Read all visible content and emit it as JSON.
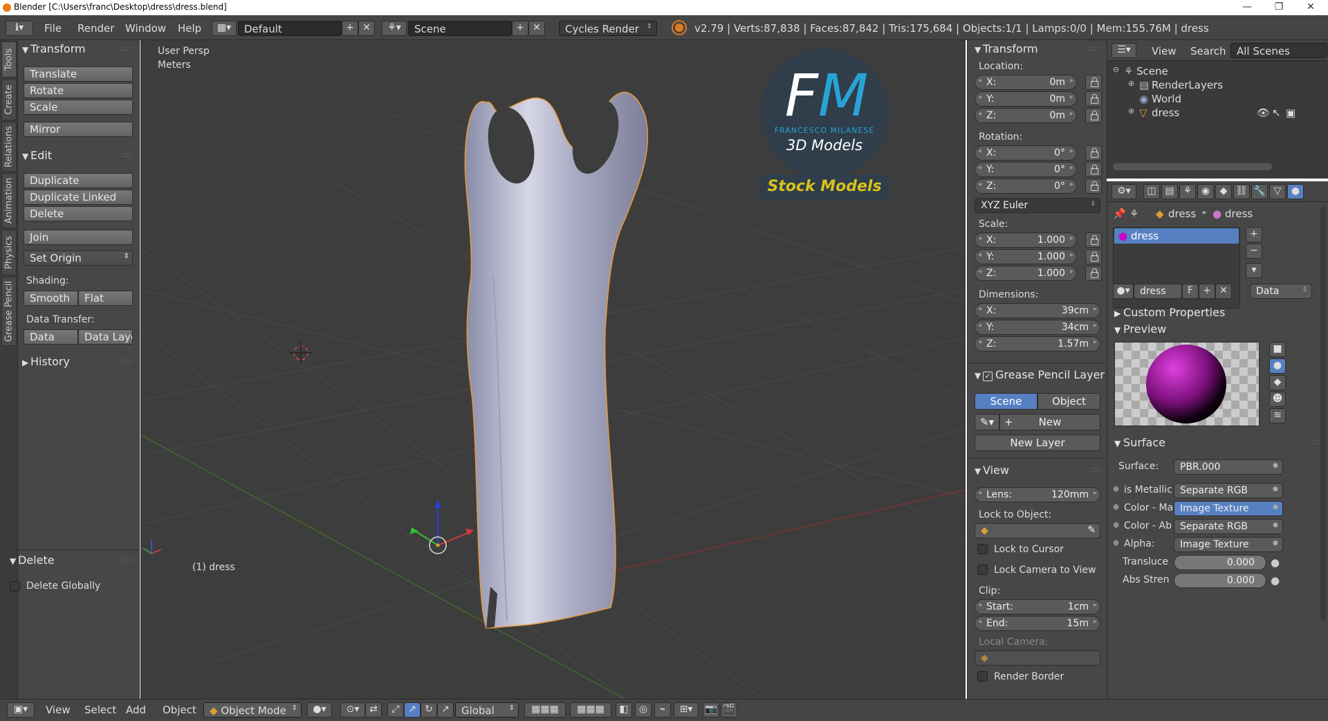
{
  "window": {
    "title": "Blender [C:\\Users\\franc\\Desktop\\dress\\dress.blend]",
    "controls": [
      "—",
      "❐",
      "✕"
    ]
  },
  "topbar": {
    "menus": [
      "File",
      "Render",
      "Window",
      "Help"
    ],
    "layout": "Default",
    "scene": "Scene",
    "engine": "Cycles Render",
    "stats": "v2.79 | Verts:87,838 | Faces:87,842 | Tris:175,684 | Objects:1/1 | Lamps:0/0 | Mem:155.76M | dress"
  },
  "left_tabs": [
    "Tools",
    "Create",
    "Relations",
    "Animation",
    "Physics",
    "Grease Pencil"
  ],
  "toolshelf": {
    "transform_title": "Transform",
    "transform_buttons": [
      "Translate",
      "Rotate",
      "Scale"
    ],
    "mirror": "Mirror",
    "edit_title": "Edit",
    "edit_buttons": [
      "Duplicate",
      "Duplicate Linked",
      "Delete"
    ],
    "join": "Join",
    "set_origin": "Set Origin",
    "shading_label": "Shading:",
    "smooth": "Smooth",
    "flat": "Flat",
    "data_transfer_label": "Data Transfer:",
    "data": "Data",
    "data_layout": "Data Layo",
    "history_title": "History",
    "operator_title": "Delete",
    "delete_globally": "Delete Globally"
  },
  "viewport": {
    "view_name": "User Persp",
    "units": "Meters",
    "object_label": "(1) dress",
    "watermark": {
      "logo": "FM",
      "brand": "FRANCESCO MILANESE",
      "subtitle": "3D Models",
      "banner": "Stock Models"
    }
  },
  "viewport_header": {
    "menus": [
      "View",
      "Select",
      "Add",
      "Object"
    ],
    "mode": "Object Mode",
    "orientation": "Global"
  },
  "npanel": {
    "transform_title": "Transform",
    "location_label": "Location:",
    "location": [
      {
        "k": "X:",
        "v": "0m"
      },
      {
        "k": "Y:",
        "v": "0m"
      },
      {
        "k": "Z:",
        "v": "0m"
      }
    ],
    "rotation_label": "Rotation:",
    "rotation": [
      {
        "k": "X:",
        "v": "0°"
      },
      {
        "k": "Y:",
        "v": "0°"
      },
      {
        "k": "Z:",
        "v": "0°"
      }
    ],
    "rotation_mode": "XYZ Euler",
    "scale_label": "Scale:",
    "scale": [
      {
        "k": "X:",
        "v": "1.000"
      },
      {
        "k": "Y:",
        "v": "1.000"
      },
      {
        "k": "Z:",
        "v": "1.000"
      }
    ],
    "dimensions_label": "Dimensions:",
    "dimensions": [
      {
        "k": "X:",
        "v": "39cm"
      },
      {
        "k": "Y:",
        "v": "34cm"
      },
      {
        "k": "Z:",
        "v": "1.57m"
      }
    ],
    "grease_title": "Grease Pencil Layer",
    "scene_btn": "Scene",
    "object_btn": "Object",
    "new_btn": "New",
    "new_layer_btn": "New Layer",
    "view_title": "View",
    "lens_k": "Lens:",
    "lens_v": "120mm",
    "lock_object_label": "Lock to Object:",
    "lock_cursor": "Lock to Cursor",
    "lock_camera": "Lock Camera to View",
    "clip_label": "Clip:",
    "clip_start_k": "Start:",
    "clip_start_v": "1cm",
    "clip_end_k": "End:",
    "clip_end_v": "15m",
    "local_camera": "Local Camera:",
    "render_border": "Render Border"
  },
  "outliner": {
    "menus": [
      "View",
      "Search"
    ],
    "filter": "All Scenes",
    "items": [
      "Scene",
      "RenderLayers",
      "World",
      "dress"
    ]
  },
  "properties": {
    "breadcrumb": [
      "dress",
      "dress"
    ],
    "material_slot": "dress",
    "material_name": "dress",
    "f_btn": "F",
    "data_dd": "Data",
    "custom_props": "Custom Properties",
    "preview_title": "Preview",
    "surface_title": "Surface",
    "surface_rows": [
      {
        "k": "Surface:",
        "v": "PBR.000",
        "hl": false
      },
      {
        "k": "is Metallic",
        "v": "Separate RGB",
        "hl": false
      },
      {
        "k": "Color - Ma",
        "v": "Image Texture",
        "hl": true
      },
      {
        "k": "Color - Ab",
        "v": "Separate RGB",
        "hl": false
      },
      {
        "k": "Alpha:",
        "v": "Image Texture",
        "hl": false
      }
    ],
    "slider_rows": [
      {
        "k": "Transluce",
        "v": "0.000"
      },
      {
        "k": "Abs Stren",
        "v": "0.000"
      }
    ]
  },
  "colors": {
    "accent_blue": "#5680c2",
    "fm_blue": "#29a3d6",
    "banner_yellow": "#d9c21c",
    "selection_orange": "#e89a3c"
  }
}
